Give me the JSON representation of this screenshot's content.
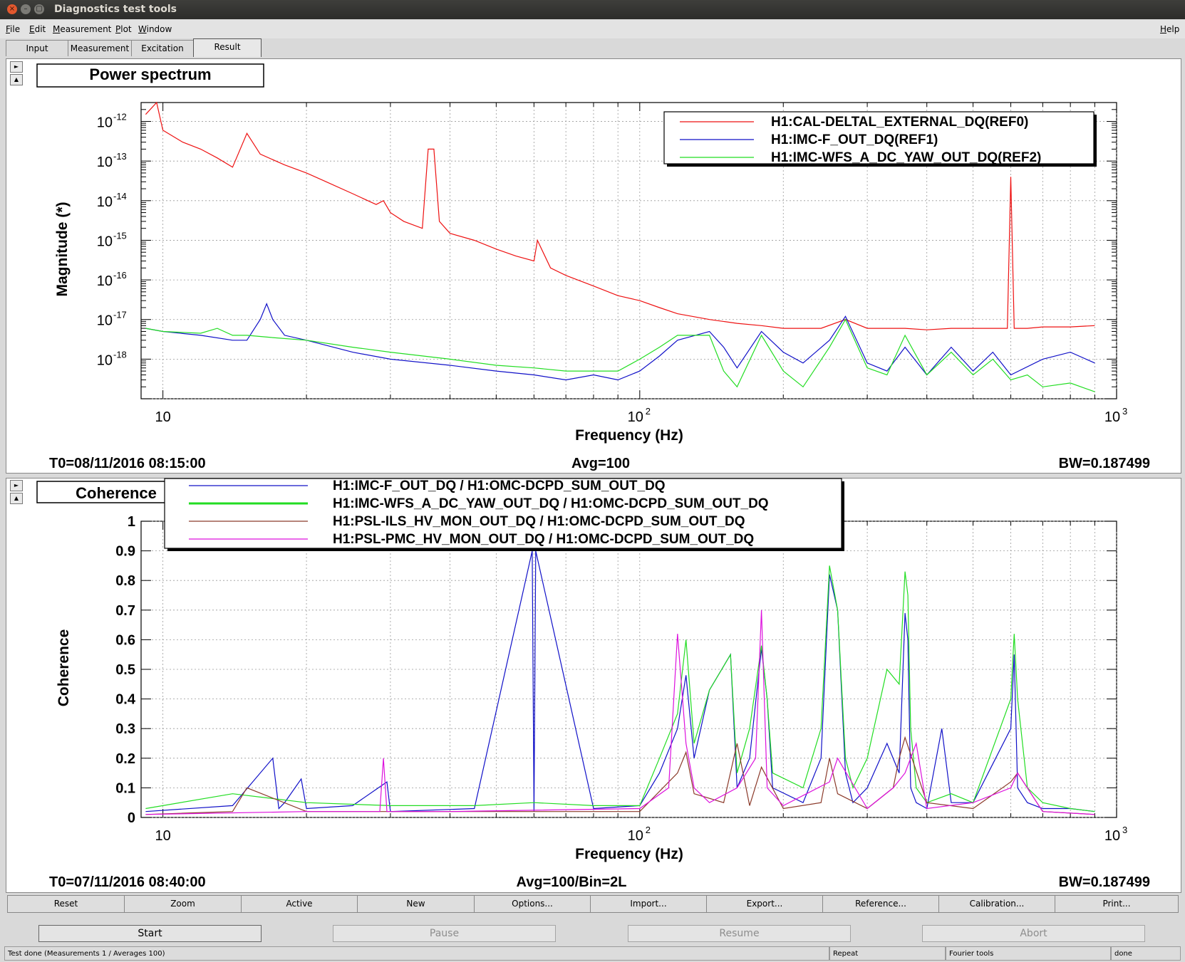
{
  "window": {
    "title": "Diagnostics test tools"
  },
  "menu": {
    "items": [
      "File",
      "Edit",
      "Measurement",
      "Plot",
      "Window"
    ],
    "help": "Help"
  },
  "tabs": [
    "Input",
    "Measurement",
    "Excitation",
    "Result"
  ],
  "colors": {
    "red": "#ee1111",
    "blue": "#1010c8",
    "green": "#22dd22",
    "brown": "#8b3a2a",
    "magenta": "#dd11dd"
  },
  "charts": {
    "power": {
      "title": "Power spectrum",
      "ylabel": "Magnitude (*)",
      "xlabel": "Frequency (Hz)",
      "x_ticks": [
        "10",
        "10",
        "2",
        "10",
        "3"
      ],
      "y_ticks": [
        {
          "base": "10",
          "exp": "-12"
        },
        {
          "base": "10",
          "exp": "-13"
        },
        {
          "base": "10",
          "exp": "-14"
        },
        {
          "base": "10",
          "exp": "-15"
        },
        {
          "base": "10",
          "exp": "-16"
        },
        {
          "base": "10",
          "exp": "-17"
        },
        {
          "base": "10",
          "exp": "-18"
        }
      ],
      "legend": [
        "H1:CAL-DELTAL_EXTERNAL_DQ(REF0)",
        "H1:IMC-F_OUT_DQ(REF1)",
        "H1:IMC-WFS_A_DC_YAW_OUT_DQ(REF2)"
      ],
      "t0": "T0=08/11/2016 08:15:00",
      "avg": "Avg=100",
      "bw": "BW=0.187499"
    },
    "coherence": {
      "title": "Coherence",
      "ylabel": "Coherence",
      "xlabel": "Frequency (Hz)",
      "x_ticks": [
        "10",
        "10",
        "2",
        "10",
        "3"
      ],
      "y_ticks": [
        "1",
        "0.9",
        "0.8",
        "0.7",
        "0.6",
        "0.5",
        "0.4",
        "0.3",
        "0.2",
        "0.1",
        "0"
      ],
      "legend": [
        "H1:IMC-F_OUT_DQ / H1:OMC-DCPD_SUM_OUT_DQ",
        "H1:IMC-WFS_A_DC_YAW_OUT_DQ / H1:OMC-DCPD_SUM_OUT_DQ",
        "H1:PSL-ILS_HV_MON_OUT_DQ / H1:OMC-DCPD_SUM_OUT_DQ",
        "H1:PSL-PMC_HV_MON_OUT_DQ / H1:OMC-DCPD_SUM_OUT_DQ"
      ],
      "t0": "T0=07/11/2016 08:40:00",
      "avg": "Avg=100/Bin=2L",
      "bw": "BW=0.187499"
    }
  },
  "chart_data": [
    {
      "type": "line",
      "title": "Power spectrum",
      "xlabel": "Frequency (Hz)",
      "ylabel": "Magnitude (*)",
      "x_scale": "log",
      "y_scale": "log",
      "xlim": [
        9,
        1000
      ],
      "ylim": [
        1e-19,
        3e-12
      ],
      "grid": true,
      "legend_position": "top-right",
      "series": [
        {
          "name": "H1:CAL-DELTAL_EXTERNAL_DQ(REF0)",
          "color": "#ee1111",
          "x": [
            9.2,
            9.7,
            10,
            11,
            12,
            13,
            14,
            15,
            16,
            18,
            20,
            22,
            25,
            28,
            29,
            30,
            32,
            35,
            36,
            37,
            38,
            40,
            45,
            50,
            55,
            60,
            61,
            65,
            70,
            80,
            90,
            100,
            110,
            120,
            140,
            160,
            180,
            200,
            240,
            270,
            300,
            330,
            360,
            400,
            450,
            500,
            590,
            600,
            610,
            650,
            700,
            800,
            900
          ],
          "y": [
            1.5e-12,
            3e-12,
            6e-13,
            3e-13,
            2e-13,
            1.2e-13,
            7e-14,
            5e-13,
            1.5e-13,
            8e-14,
            5e-14,
            3e-14,
            1.5e-14,
            8e-15,
            1e-14,
            5e-15,
            3e-15,
            2e-15,
            2e-13,
            2e-13,
            3e-15,
            1.5e-15,
            1e-15,
            6e-16,
            4e-16,
            3e-16,
            1e-15,
            2e-16,
            1.3e-16,
            7e-17,
            4e-17,
            3e-17,
            2e-17,
            1.4e-17,
            1e-17,
            8e-18,
            7e-18,
            6e-18,
            6e-18,
            1e-17,
            6e-18,
            6e-18,
            6e-18,
            5.5e-18,
            6e-18,
            6e-18,
            6e-18,
            4e-14,
            6e-18,
            6e-18,
            6.5e-18,
            6.5e-18,
            7e-18
          ]
        },
        {
          "name": "H1:IMC-F_OUT_DQ(REF1)",
          "color": "#1010c8",
          "x": [
            9.2,
            10,
            12,
            14,
            15,
            16,
            16.5,
            17,
            18,
            20,
            25,
            30,
            40,
            50,
            60,
            70,
            80,
            90,
            100,
            110,
            120,
            140,
            150,
            160,
            180,
            200,
            220,
            250,
            270,
            300,
            330,
            360,
            400,
            450,
            500,
            550,
            600,
            700,
            800,
            900
          ],
          "y": [
            6e-18,
            5e-18,
            4e-18,
            3e-18,
            3e-18,
            1e-17,
            2.5e-17,
            1e-17,
            4e-18,
            3e-18,
            1.5e-18,
            1e-18,
            7e-19,
            5e-19,
            4e-19,
            3e-19,
            4e-19,
            3e-19,
            5e-19,
            1.2e-18,
            3e-18,
            5e-18,
            2e-18,
            6e-19,
            5e-18,
            1.5e-18,
            8e-19,
            3e-18,
            1.2e-17,
            8e-19,
            5e-19,
            2e-18,
            4e-19,
            2e-18,
            5e-19,
            1.5e-18,
            4e-19,
            1e-18,
            1.5e-18,
            8e-19
          ]
        },
        {
          "name": "H1:IMC-WFS_A_DC_YAW_OUT_DQ(REF2)",
          "color": "#22dd22",
          "x": [
            9.2,
            10,
            12,
            13,
            14,
            15,
            17,
            20,
            25,
            30,
            40,
            50,
            60,
            70,
            80,
            90,
            100,
            110,
            120,
            140,
            150,
            160,
            180,
            200,
            220,
            250,
            270,
            300,
            330,
            360,
            400,
            450,
            500,
            550,
            600,
            650,
            700,
            800,
            900
          ],
          "y": [
            6e-18,
            5e-18,
            4.5e-18,
            6e-18,
            4e-18,
            4e-18,
            3.5e-18,
            3e-18,
            2e-18,
            1.5e-18,
            1e-18,
            7e-19,
            6e-19,
            5e-19,
            5e-19,
            5e-19,
            1e-18,
            2e-18,
            4e-18,
            4e-18,
            5e-19,
            2e-19,
            4e-18,
            5e-19,
            2e-19,
            2e-18,
            1e-17,
            6e-19,
            4e-19,
            4e-18,
            4e-19,
            1.5e-18,
            4e-19,
            1e-18,
            3e-19,
            4e-19,
            2e-19,
            2.5e-19,
            1.5e-19
          ]
        }
      ]
    },
    {
      "type": "line",
      "title": "Coherence",
      "xlabel": "Frequency (Hz)",
      "ylabel": "Coherence",
      "x_scale": "log",
      "y_scale": "linear",
      "xlim": [
        9,
        1000
      ],
      "ylim": [
        0,
        1
      ],
      "grid": true,
      "legend_position": "top",
      "series": [
        {
          "name": "H1:IMC-F_OUT_DQ / H1:OMC-DCPD_SUM_OUT_DQ",
          "color": "#1010c8",
          "x": [
            9.2,
            14,
            17,
            17.5,
            18,
            19.5,
            20,
            25,
            29.5,
            30,
            45,
            59.5,
            60,
            60.5,
            80,
            100,
            110,
            120,
            125,
            130,
            140,
            155,
            160,
            170,
            180,
            185,
            190,
            220,
            240,
            250,
            260,
            270,
            280,
            300,
            330,
            350,
            360,
            365,
            370,
            380,
            400,
            430,
            450,
            500,
            600,
            610,
            620,
            650,
            700,
            800,
            900
          ],
          "y": [
            0.02,
            0.04,
            0.2,
            0.03,
            0.05,
            0.13,
            0.03,
            0.04,
            0.12,
            0.02,
            0.03,
            0.9,
            0.02,
            0.9,
            0.03,
            0.04,
            0.15,
            0.3,
            0.48,
            0.2,
            0.43,
            0.55,
            0.1,
            0.2,
            0.57,
            0.4,
            0.1,
            0.05,
            0.2,
            0.82,
            0.7,
            0.15,
            0.05,
            0.1,
            0.25,
            0.15,
            0.69,
            0.6,
            0.1,
            0.05,
            0.03,
            0.3,
            0.05,
            0.05,
            0.3,
            0.55,
            0.1,
            0.05,
            0.03,
            0.03,
            0.02
          ]
        },
        {
          "name": "H1:IMC-WFS_A_DC_YAW_OUT_DQ / H1:OMC-DCPD_SUM_OUT_DQ",
          "color": "#22dd22",
          "x": [
            9.2,
            14,
            20,
            30,
            45,
            60,
            80,
            100,
            110,
            120,
            125,
            130,
            140,
            155,
            160,
            170,
            180,
            185,
            190,
            220,
            240,
            250,
            260,
            270,
            280,
            300,
            330,
            350,
            360,
            365,
            370,
            380,
            400,
            450,
            500,
            600,
            610,
            620,
            650,
            700,
            800,
            900
          ],
          "y": [
            0.03,
            0.08,
            0.05,
            0.04,
            0.04,
            0.05,
            0.04,
            0.04,
            0.2,
            0.35,
            0.6,
            0.25,
            0.43,
            0.55,
            0.15,
            0.3,
            0.58,
            0.4,
            0.15,
            0.1,
            0.3,
            0.85,
            0.7,
            0.2,
            0.1,
            0.2,
            0.5,
            0.45,
            0.83,
            0.75,
            0.3,
            0.1,
            0.05,
            0.08,
            0.05,
            0.4,
            0.62,
            0.4,
            0.1,
            0.05,
            0.03,
            0.02
          ]
        },
        {
          "name": "H1:PSL-ILS_HV_MON_OUT_DQ / H1:OMC-DCPD_SUM_OUT_DQ",
          "color": "#8b3a2a",
          "x": [
            9.2,
            14,
            15,
            20,
            30,
            60,
            100,
            120,
            125,
            130,
            150,
            160,
            170,
            180,
            200,
            240,
            250,
            260,
            300,
            340,
            350,
            360,
            400,
            500,
            600,
            620,
            700,
            900
          ],
          "y": [
            0.01,
            0.02,
            0.1,
            0.02,
            0.02,
            0.02,
            0.02,
            0.15,
            0.22,
            0.08,
            0.05,
            0.25,
            0.04,
            0.17,
            0.03,
            0.05,
            0.2,
            0.08,
            0.03,
            0.1,
            0.2,
            0.27,
            0.05,
            0.03,
            0.12,
            0.15,
            0.02,
            0.01
          ]
        },
        {
          "name": "H1:PSL-PMC_HV_MON_OUT_DQ / H1:OMC-DCPD_SUM_OUT_DQ",
          "color": "#dd11dd",
          "x": [
            9.2,
            20,
            28.5,
            29,
            29.5,
            40,
            100,
            115,
            120,
            125,
            130,
            140,
            160,
            175,
            180,
            185,
            200,
            250,
            260,
            300,
            340,
            360,
            380,
            400,
            500,
            600,
            620,
            700,
            900
          ],
          "y": [
            0.01,
            0.02,
            0.02,
            0.2,
            0.02,
            0.02,
            0.03,
            0.1,
            0.62,
            0.25,
            0.1,
            0.05,
            0.1,
            0.2,
            0.7,
            0.1,
            0.04,
            0.12,
            0.2,
            0.03,
            0.1,
            0.15,
            0.25,
            0.03,
            0.05,
            0.1,
            0.15,
            0.02,
            0.01
          ]
        }
      ]
    }
  ],
  "buttons": [
    "Reset",
    "Zoom",
    "Active",
    "New",
    "Options...",
    "Import...",
    "Export...",
    "Reference...",
    "Calibration...",
    "Print..."
  ],
  "commands": {
    "start": "Start",
    "pause": "Pause",
    "resume": "Resume",
    "abort": "Abort"
  },
  "status": {
    "main": "Test done (Measurements 1 / Averages 100)",
    "mode": "Repeat",
    "tool": "Fourier tools",
    "state": "done"
  },
  "panel_arrows": {
    "up": "▲",
    "down": "▼",
    "right": "►"
  }
}
